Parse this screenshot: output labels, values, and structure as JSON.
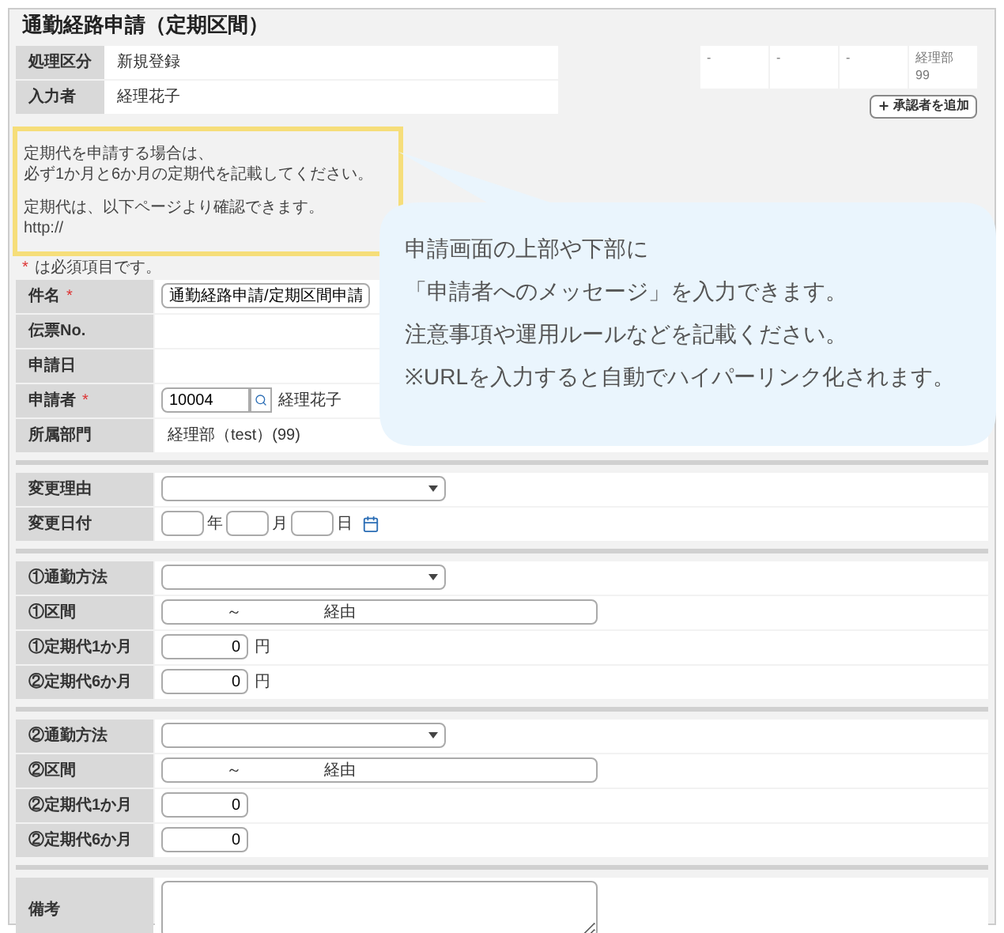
{
  "title": "通勤経路申請（定期区間）",
  "header": [
    {
      "label": "処理区分",
      "value": "新規登録"
    },
    {
      "label": "入力者",
      "value": "経理花子"
    }
  ],
  "approvers": [
    {
      "lines": [
        "-"
      ]
    },
    {
      "lines": [
        "-"
      ]
    },
    {
      "lines": [
        "-"
      ]
    },
    {
      "lines": [
        "経理部",
        "99"
      ]
    }
  ],
  "add_approver_button": "承認者を追加",
  "message": [
    [
      "定期代を申請する場合は、",
      "必ず1か月と6か月の定期代を記載してください。"
    ],
    [
      "定期代は、以下ページより確認できます。",
      "http://"
    ]
  ],
  "required_mark": "*",
  "required_note": "は必須項目です。",
  "sections": [
    {
      "rows": [
        {
          "label": "件名",
          "required": true,
          "kind": "text",
          "value": "通勤経路申請/定期区間申請"
        },
        {
          "label": "伝票No.",
          "required": false,
          "kind": "static"
        },
        {
          "label": "申請日",
          "required": false,
          "kind": "static"
        },
        {
          "label": "申請者",
          "required": true,
          "kind": "lookup",
          "value": "10004",
          "name": "経理花子"
        },
        {
          "label": "所属部門",
          "required": false,
          "kind": "static",
          "value": "経理部（test）(99)"
        }
      ]
    },
    {
      "rows": [
        {
          "label": "変更理由",
          "required": false,
          "kind": "select"
        },
        {
          "label": "変更日付",
          "required": false,
          "kind": "date",
          "units": [
            "年",
            "月",
            "日"
          ]
        }
      ]
    },
    {
      "rows": [
        {
          "label": "①通勤方法",
          "required": false,
          "kind": "select"
        },
        {
          "label": "①区間",
          "required": false,
          "kind": "route",
          "tilde": "～",
          "via": "経由"
        },
        {
          "label": "①定期代1か月",
          "required": false,
          "kind": "amount",
          "value": "0",
          "unit": "円"
        },
        {
          "label": "②定期代6か月",
          "required": false,
          "kind": "amount",
          "value": "0",
          "unit": "円"
        }
      ]
    },
    {
      "rows": [
        {
          "label": "②通勤方法",
          "required": false,
          "kind": "select"
        },
        {
          "label": "②区間",
          "required": false,
          "kind": "route",
          "tilde": "～",
          "via": "経由"
        },
        {
          "label": "②定期代1か月",
          "required": false,
          "kind": "amount",
          "value": "0"
        },
        {
          "label": "②定期代6か月",
          "required": false,
          "kind": "amount",
          "value": "0"
        }
      ]
    },
    {
      "rows": [
        {
          "label": "備考",
          "required": false,
          "kind": "textarea"
        }
      ]
    }
  ],
  "callout": [
    "申請画面の上部や下部に",
    "「申請者へのメッセージ」を入力できます。",
    "注意事項や運用ルールなどを記載ください。",
    "※URLを入力すると自動でハイパーリンク化されます。"
  ]
}
